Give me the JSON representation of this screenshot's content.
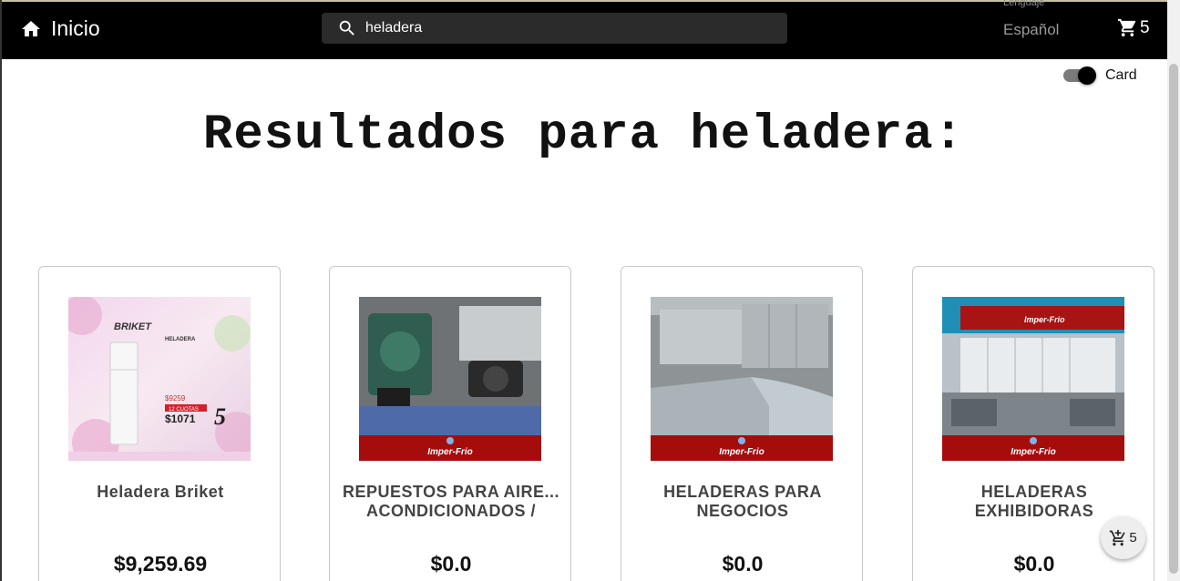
{
  "header": {
    "home_label": "Inicio",
    "search": {
      "value": "heladera",
      "placeholder": ""
    },
    "language": {
      "caption": "Lenguaje",
      "value": "Español"
    },
    "cart_count": "5"
  },
  "view_toggle": {
    "label": "Card",
    "on": true
  },
  "results_heading": "Resultados para heladera:",
  "products": [
    {
      "title": "Heladera Briket",
      "price": "$9,259.69",
      "image": "briket-refrigerator-ad",
      "brand_banner": "",
      "ad_text": {
        "brand": "BRIKET",
        "model": "HELADERA",
        "promo": "12 CUOTAS",
        "price_big": "$1071",
        "price_small": "$9259"
      }
    },
    {
      "title": "REPUESTOS PARA AIRE... ACONDICIONADOS /",
      "price": "$0.0",
      "image": "ac-parts-photo",
      "brand_banner": "Imper-Frio"
    },
    {
      "title": "HELADERAS PARA NEGOCIOS",
      "price": "$0.0",
      "image": "commercial-fridges-photo",
      "brand_banner": "Imper-Frio"
    },
    {
      "title": "HELADERAS EXHIBIDORAS",
      "price": "$0.0",
      "image": "display-fridges-photo",
      "brand_banner": "Imper-Frio",
      "shop_sign": "Imper-Frio"
    }
  ],
  "floating_cart": {
    "count": "5"
  },
  "colors": {
    "topbar": "#000000",
    "banner_red": "#a50d0d",
    "search_bg": "#2b2b2b"
  }
}
